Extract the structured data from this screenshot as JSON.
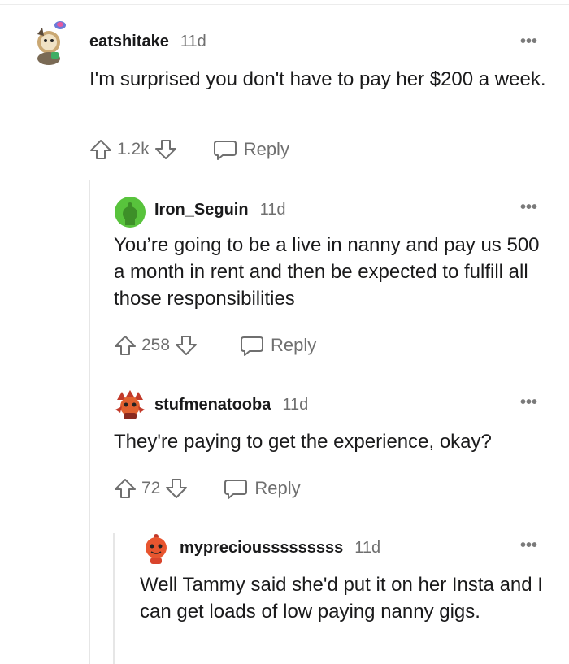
{
  "comments": [
    {
      "username": "eatshitake",
      "time": "11d",
      "text": "I'm surprised you don't have to pay her $200 a week.",
      "score": "1.2k",
      "reply_label": "Reply",
      "more_label": "•••",
      "avatar_icon": "snoo-avatar-icon"
    },
    {
      "username": "Iron_Seguin",
      "time": "11d",
      "text": "You’re going to be a live in nanny and pay us 500 a month in rent and then be expected to fulfill all those responsibilities",
      "score": "258",
      "reply_label": "Reply",
      "more_label": "•••",
      "avatar_icon": "snoo-avatar-icon"
    },
    {
      "username": "stufmenatooba",
      "time": "11d",
      "text": "They're paying to get the experience, okay?",
      "score": "72",
      "reply_label": "Reply",
      "more_label": "•••",
      "avatar_icon": "snoo-avatar-icon"
    },
    {
      "username": "mypreciousssssssss",
      "time": "11d",
      "text": "Well Tammy said she'd put it on her Insta and I can get loads of low paying nanny gigs.",
      "more_label": "•••",
      "avatar_icon": "snoo-avatar-icon"
    }
  ],
  "colors": {
    "text": "#1a1a1b",
    "muted": "#6f6f6f",
    "thread_line": "#e6e6e6",
    "green_avatar": "#58c33c",
    "red_avatar": "#d9442c"
  }
}
